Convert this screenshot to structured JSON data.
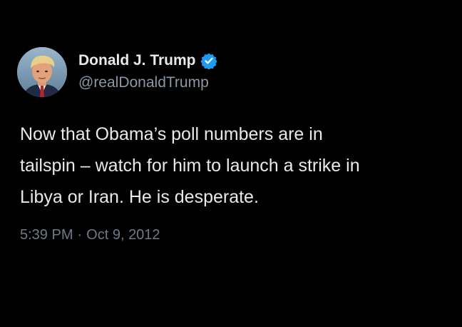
{
  "author": {
    "display_name": "Donald J. Trump",
    "handle": "@realDonaldTrump",
    "verified": true,
    "avatar_icon": "profile-photo",
    "verified_icon": "verified-badge-icon",
    "verified_color": "#1d9bf0"
  },
  "tweet": {
    "text": "Now that Obama’s poll numbers are in\ntailspin – watch for him to launch a strike in\nLibya or Iran.  He is desperate."
  },
  "meta": {
    "time": "5:39 PM",
    "separator": "·",
    "date": "Oct 9, 2012"
  },
  "colors": {
    "background": "#000000",
    "primary_text": "#e7e9ea",
    "secondary_text": "#8b98a5"
  }
}
